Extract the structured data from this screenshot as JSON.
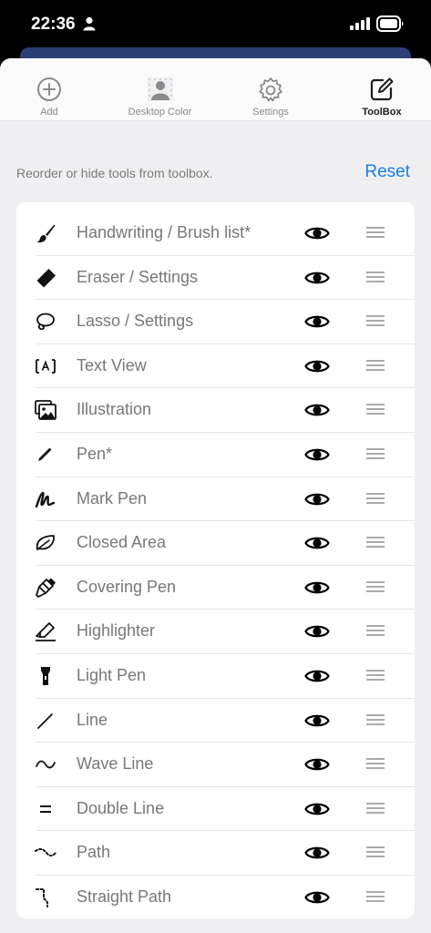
{
  "status_bar": {
    "time": "22:36"
  },
  "tabs": [
    {
      "label": "Add",
      "icon": "add-circle-icon",
      "active": false
    },
    {
      "label": "Desktop Color",
      "icon": "desktop-color-icon",
      "active": false
    },
    {
      "label": "Settings",
      "icon": "gear-icon",
      "active": false
    },
    {
      "label": "ToolBox",
      "icon": "compose-icon",
      "active": true
    }
  ],
  "hint": "Reorder or hide tools from toolbox.",
  "reset_label": "Reset",
  "tools": [
    {
      "label": "Handwriting / Brush list*",
      "icon": "brush-icon",
      "visible": true
    },
    {
      "label": "Eraser / Settings",
      "icon": "eraser-icon",
      "visible": true
    },
    {
      "label": "Lasso / Settings",
      "icon": "lasso-icon",
      "visible": true
    },
    {
      "label": "Text View",
      "icon": "text-box-icon",
      "visible": true
    },
    {
      "label": "Illustration",
      "icon": "illustration-icon",
      "visible": true
    },
    {
      "label": "Pen*",
      "icon": "pen-icon",
      "visible": true
    },
    {
      "label": "Mark Pen",
      "icon": "mark-pen-icon",
      "visible": true
    },
    {
      "label": "Closed Area",
      "icon": "closed-area-icon",
      "visible": true
    },
    {
      "label": "Covering Pen",
      "icon": "covering-pen-icon",
      "visible": true
    },
    {
      "label": "Highlighter",
      "icon": "highlighter-icon",
      "visible": true
    },
    {
      "label": "Light Pen",
      "icon": "flashlight-icon",
      "visible": true
    },
    {
      "label": "Line",
      "icon": "line-icon",
      "visible": true
    },
    {
      "label": "Wave Line",
      "icon": "wave-line-icon",
      "visible": true
    },
    {
      "label": "Double Line",
      "icon": "double-line-icon",
      "visible": true
    },
    {
      "label": "Path",
      "icon": "path-icon",
      "visible": true
    },
    {
      "label": "Straight Path",
      "icon": "straight-path-icon",
      "visible": true
    }
  ],
  "colors": {
    "accent": "#1a7fe0",
    "label": "#77777c",
    "background": "#efeff1"
  }
}
